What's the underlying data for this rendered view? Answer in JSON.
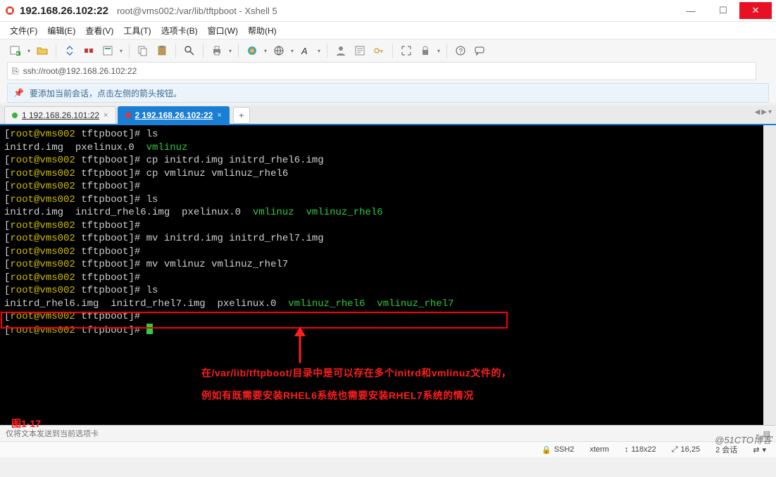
{
  "title": {
    "ip": "192.168.26.102:22",
    "path": "root@vms002:/var/lib/tftpboot - Xshell 5"
  },
  "menu": [
    "文件(F)",
    "编辑(E)",
    "查看(V)",
    "工具(T)",
    "选项卡(B)",
    "窗口(W)",
    "帮助(H)"
  ],
  "address": "ssh://root@192.168.26.102:22",
  "info_hint": "要添加当前会话，点击左侧的箭头按钮。",
  "tabs": {
    "items": [
      {
        "label": "1 192.168.26.101:22",
        "active": false
      },
      {
        "label": "2 192.168.26.102:22",
        "active": true
      }
    ]
  },
  "terminal": {
    "prompt_user": "root@vms002",
    "prompt_dir": "tftpboot",
    "lines": [
      {
        "cmd": "ls"
      },
      {
        "out": [
          {
            "t": "initrd.img  pxelinux.0  ",
            "c": "w"
          },
          {
            "t": "vmlinuz",
            "c": "g"
          }
        ]
      },
      {
        "cmd": "cp initrd.img initrd_rhel6.img"
      },
      {
        "cmd": "cp vmlinuz vmlinuz_rhel6"
      },
      {
        "cmd": ""
      },
      {
        "cmd": "ls"
      },
      {
        "out": [
          {
            "t": "initrd.img  initrd_rhel6.img  pxelinux.0  ",
            "c": "w"
          },
          {
            "t": "vmlinuz",
            "c": "g"
          },
          {
            "t": "  ",
            "c": "w"
          },
          {
            "t": "vmlinuz_rhel6",
            "c": "g"
          }
        ]
      },
      {
        "cmd": ""
      },
      {
        "cmd": "mv initrd.img initrd_rhel7.img"
      },
      {
        "cmd": ""
      },
      {
        "cmd": "mv vmlinuz vmlinuz_rhel7"
      },
      {
        "cmd": ""
      },
      {
        "cmd": "ls"
      },
      {
        "out": [
          {
            "t": "initrd_rhel6.img  initrd_rhel7.img  pxelinux.0  ",
            "c": "w"
          },
          {
            "t": "vmlinuz_rhel6",
            "c": "g"
          },
          {
            "t": "  ",
            "c": "w"
          },
          {
            "t": "vmlinuz_rhel7",
            "c": "g"
          }
        ]
      },
      {
        "cmd": ""
      },
      {
        "cmd": "",
        "cursor": true
      }
    ]
  },
  "annotation": {
    "line1": "在/var/lib/tftpboot/目录中是可以存在多个initrd和vmlinuz文件的，",
    "line2": "例如有既需要安装RHEL6系统也需要安装RHEL7系统的情况",
    "figure": "图1-17"
  },
  "watermark": "@51CTO博客",
  "sendbar": {
    "placeholder": "仅将文本发送到当前选项卡"
  },
  "status": {
    "proto": "SSH2",
    "term": "xterm",
    "size": "118x22",
    "pos": "16,25",
    "sessions": "2 会话"
  },
  "icons": {
    "minimize": "—",
    "maximize": "☐",
    "close": "✕",
    "lock": "🔒",
    "plus": "+",
    "left": "◀",
    "right": "▶",
    "dd": "▾",
    "updown": "↕",
    "resize": "⤢",
    "connect": "🔗",
    "arrows": "⇄"
  }
}
